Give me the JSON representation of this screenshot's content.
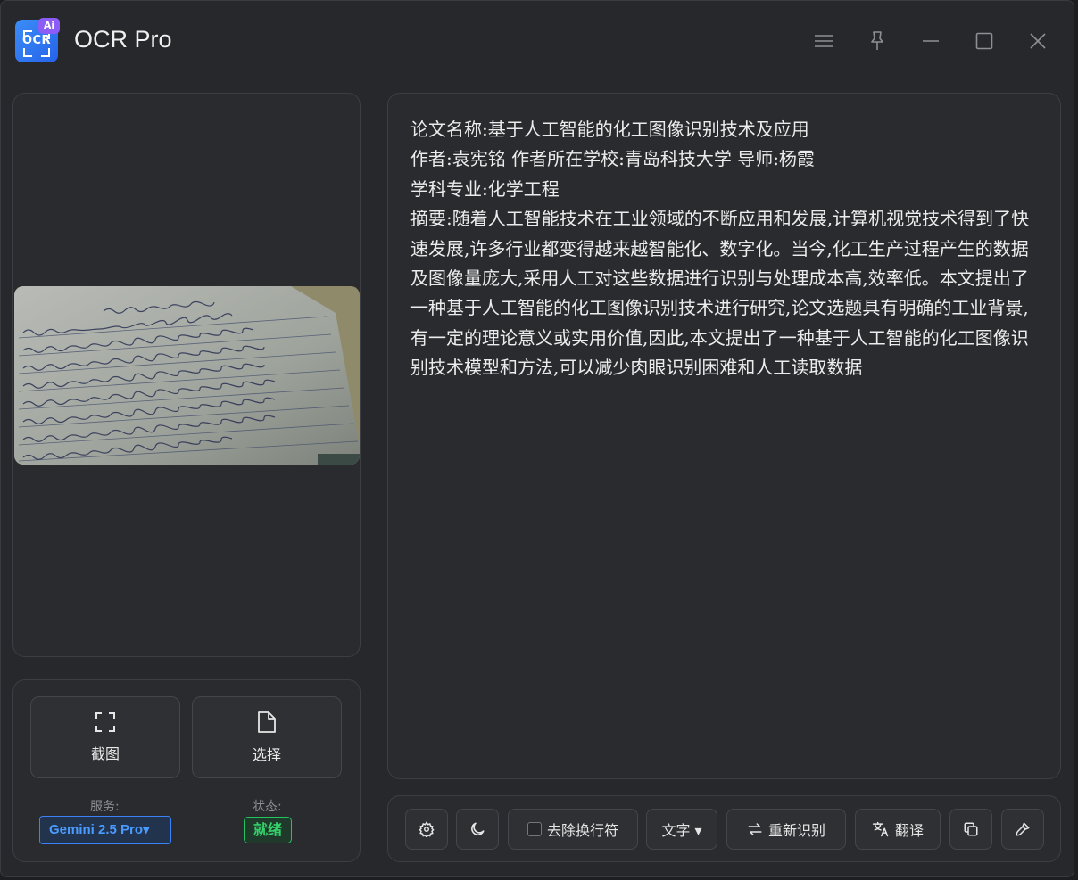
{
  "app": {
    "title": "OCR Pro",
    "logo_text": "OCR",
    "logo_badge": "Ai"
  },
  "window_controls": {
    "menu_icon": "hamburger-icon",
    "pin_icon": "pin-icon",
    "minimize_icon": "minimize-icon",
    "maximize_icon": "maximize-icon",
    "close_icon": "close-icon"
  },
  "actions": {
    "screenshot_label": "截图",
    "select_label": "选择"
  },
  "service": {
    "label": "服务:",
    "value": "Gemini 2.5 Pro▾"
  },
  "status": {
    "label": "状态:",
    "value": "就绪"
  },
  "result": {
    "text": "论文名称:基于人工智能的化工图像识别技术及应用\n作者:袁宪铭 作者所在学校:青岛科技大学 导师:杨霞\n学科专业:化学工程\n摘要:随着人工智能技术在工业领域的不断应用和发展,计算机视觉技术得到了快速发展,许多行业都变得越来越智能化、数字化。当今,化工生产过程产生的数据及图像量庞大,采用人工对这些数据进行识别与处理成本高,效率低。本文提出了一种基于人工智能的化工图像识别技术进行研究,论文选题具有明确的工业背景,有一定的理论意义或实用价值,因此,本文提出了一种基于人工智能的化工图像识别技术模型和方法,可以减少肉眼识别困难和人工读取数据"
  },
  "toolbar": {
    "settings_icon": "gear-icon",
    "theme_icon": "moon-icon",
    "remove_linebreaks_label": "去除换行符",
    "mode_label": "文字 ▾",
    "reocr_label": "重新识别",
    "translate_label": "翻译",
    "copy_icon": "copy-icon",
    "clear_icon": "brush-icon"
  },
  "colors": {
    "accent": "#3b82f6",
    "status_ok": "#22c55e",
    "logo_badge": "#8b5cf6"
  }
}
